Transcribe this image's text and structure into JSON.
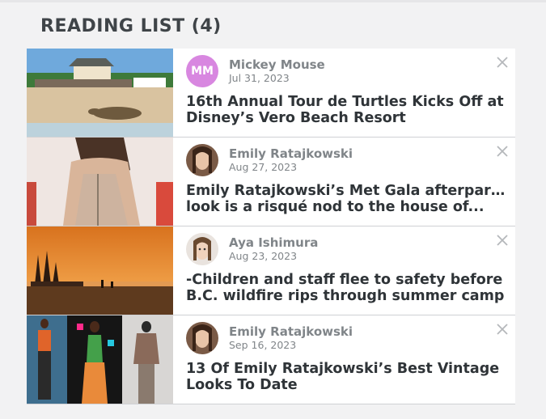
{
  "reading_list": {
    "title": "READING LIST (4)",
    "items": [
      {
        "author": "Mickey Mouse",
        "initials": "MM",
        "date": "Jul 31, 2023",
        "headline_line1": "16th Annual Tour de Turtles Kicks Off at",
        "headline_line2": "Disney’s Vero Beach Resort"
      },
      {
        "author": "Emily Ratajkowski",
        "date": "Aug 27, 2023",
        "headline_line1": "Emily Ratajkowski’s Met Gala afterparty",
        "headline_line2": "look is a risqué nod to the house of..."
      },
      {
        "author": "Aya Ishimura",
        "date": "Aug 23, 2023",
        "headline_line1": "-Children and staff flee to safety before",
        "headline_line2": "B.C. wildfire rips through summer camp"
      },
      {
        "author": "Emily Ratajkowski",
        "date": "Sep 16, 2023",
        "headline_line1": "13 Of Emily Ratajkowski’s Best Vintage",
        "headline_line2": "Looks To Date"
      }
    ]
  },
  "colors": {
    "avatar_initials_bg": "#d887e0",
    "headline": "#2f3438",
    "meta": "#808589",
    "background": "#f2f2f3"
  }
}
